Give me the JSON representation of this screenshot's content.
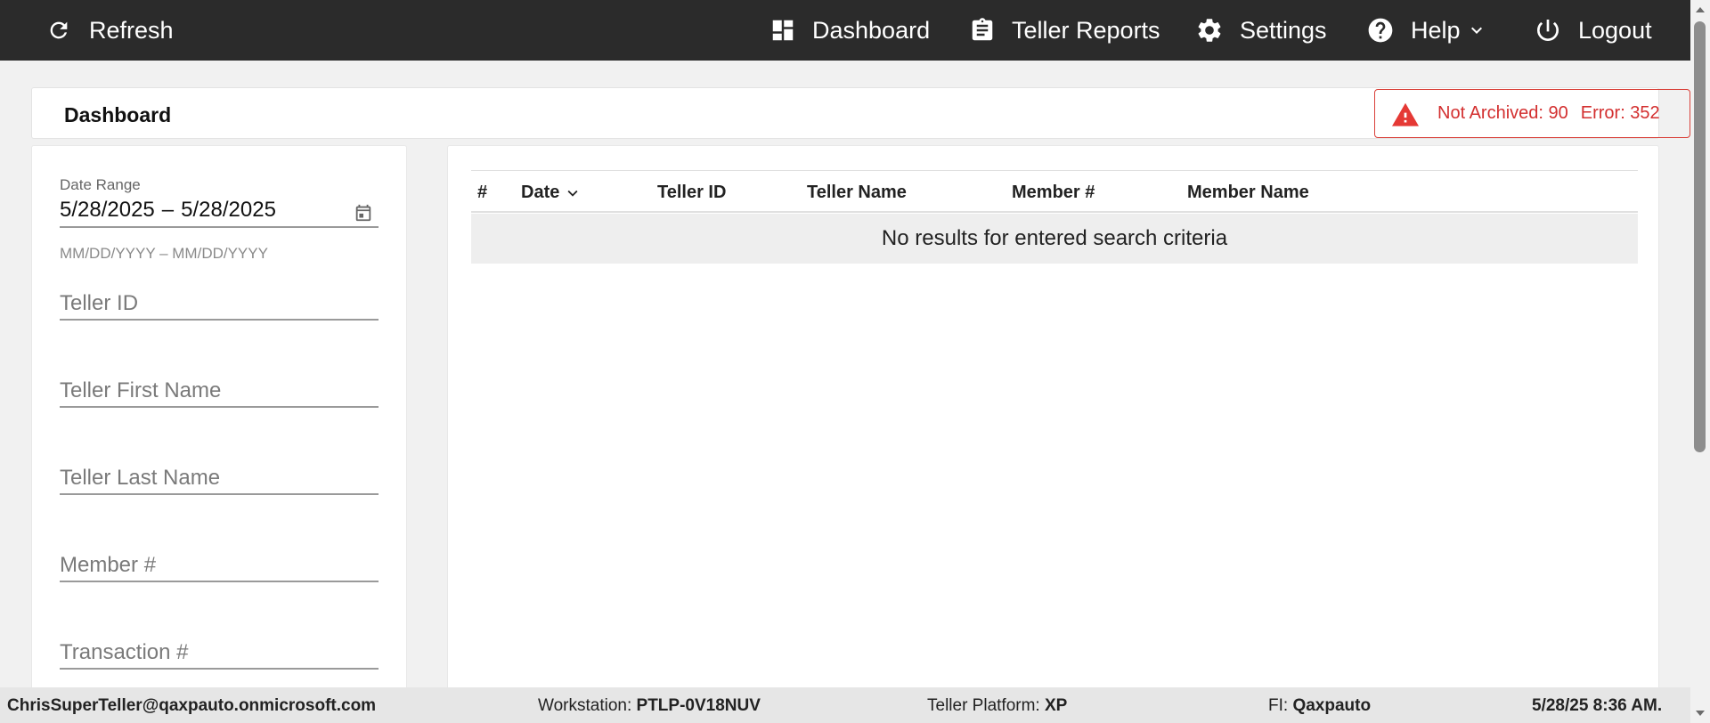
{
  "topbar": {
    "refresh_label": "Refresh",
    "dashboard_label": "Dashboard",
    "teller_reports_label": "Teller Reports",
    "settings_label": "Settings",
    "help_label": "Help",
    "logout_label": "Logout"
  },
  "header": {
    "title": "Dashboard",
    "alert": {
      "not_archived_text": "Not Archived: 90",
      "error_text": "Error: 352",
      "color": "#d32f2f"
    }
  },
  "filters": {
    "date_range_label": "Date Range",
    "date_start": "5/28/2025",
    "date_separator": "–",
    "date_end": "5/28/2025",
    "date_hint": "MM/DD/YYYY – MM/DD/YYYY",
    "teller_id_placeholder": "Teller ID",
    "teller_first_name_placeholder": "Teller First Name",
    "teller_last_name_placeholder": "Teller Last Name",
    "member_placeholder": "Member #",
    "transaction_placeholder": "Transaction #"
  },
  "table": {
    "columns": [
      "#",
      "Date",
      "Teller ID",
      "Teller Name",
      "Member #",
      "Member Name"
    ],
    "empty_message": "No results for entered search criteria"
  },
  "statusbar": {
    "user": "ChrisSuperTeller@qaxpauto.onmicrosoft.com",
    "workstation_label": "Workstation:",
    "workstation_value": "PTLP-0V18NUV",
    "platform_label": "Teller Platform:",
    "platform_value": "XP",
    "fi_label": "FI:",
    "fi_value": "Qaxpauto",
    "datetime": "5/28/25 8:36 AM."
  },
  "icons": [
    "refresh-icon",
    "dashboard-icon",
    "clipboard-icon",
    "gear-icon",
    "help-icon",
    "chevron-down-icon",
    "power-icon",
    "warning-icon",
    "calendar-icon"
  ]
}
